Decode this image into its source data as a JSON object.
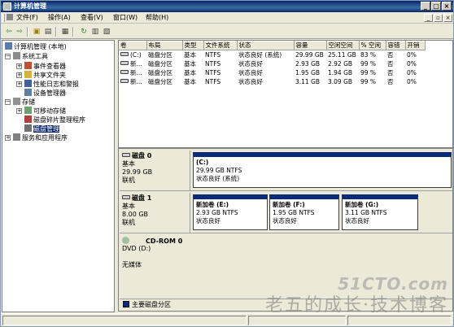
{
  "window": {
    "title": "计算机管理"
  },
  "menu": {
    "items": [
      {
        "label": "文件(F)"
      },
      {
        "label": "操作(A)"
      },
      {
        "label": "查看(V)"
      },
      {
        "label": "窗口(W)"
      },
      {
        "label": "帮助(H)"
      }
    ]
  },
  "toolbar": {
    "icons": [
      "back-icon",
      "forward-icon",
      "up-folder-icon",
      "show-tree-icon",
      "properties-icon",
      "refresh-icon",
      "help-icon",
      "console-icon"
    ]
  },
  "tree": {
    "root": "计算机管理 (本地)",
    "system_tools": "系统工具",
    "event_viewer": "事件查看器",
    "shared_folders": "共享文件夹",
    "perf_logs": "性能日志和警报",
    "device_manager": "设备管理器",
    "storage": "存储",
    "removable_storage": "可移动存储",
    "defrag": "磁盘碎片整理程序",
    "disk_mgmt": "磁盘管理",
    "services_apps": "服务和应用程序"
  },
  "volumes": {
    "headers": [
      "卷",
      "布局",
      "类型",
      "文件系统",
      "状态",
      "容量",
      "空闲空间",
      "% 空闲",
      "容错",
      "开销"
    ],
    "rows": [
      [
        "(C:)",
        "磁盘分区",
        "基本",
        "NTFS",
        "状态良好 (系统)",
        "29.99 GB",
        "25.11 GB",
        "83 %",
        "否",
        "0%"
      ],
      [
        "新...",
        "磁盘分区",
        "基本",
        "NTFS",
        "状态良好",
        "2.93 GB",
        "2.92 GB",
        "99 %",
        "否",
        "0%"
      ],
      [
        "新...",
        "磁盘分区",
        "基本",
        "NTFS",
        "状态良好",
        "1.95 GB",
        "1.94 GB",
        "99 %",
        "否",
        "0%"
      ],
      [
        "新...",
        "磁盘分区",
        "基本",
        "NTFS",
        "状态良好",
        "3.11 GB",
        "3.09 GB",
        "99 %",
        "否",
        "0%"
      ]
    ]
  },
  "disks": {
    "disk0": {
      "name": "磁盘 0",
      "type": "基本",
      "size": "29.99 GB",
      "status": "联机",
      "partitions": [
        {
          "name": "(C:)",
          "size": "29.99 GB NTFS",
          "status": "状态良好 (系统)"
        }
      ]
    },
    "disk1": {
      "name": "磁盘 1",
      "type": "基本",
      "size": "8.00 GB",
      "status": "联机",
      "partitions": [
        {
          "name": "新加卷  (E:)",
          "size": "2.93 GB NTFS",
          "status": "状态良好"
        },
        {
          "name": "新加卷  (F:)",
          "size": "1.95 GB NTFS",
          "status": "状态良好"
        },
        {
          "name": "新加卷  (G:)",
          "size": "3.11 GB NTFS",
          "status": "状态良好"
        }
      ]
    },
    "cdrom0": {
      "name": "CD-ROM 0",
      "type": "DVD (D:)",
      "status": "无媒体"
    }
  },
  "legend": {
    "primary": "主要磁盘分区"
  },
  "watermark": {
    "brand": "51CTO.com",
    "text": "老五的成长·技术博客"
  }
}
